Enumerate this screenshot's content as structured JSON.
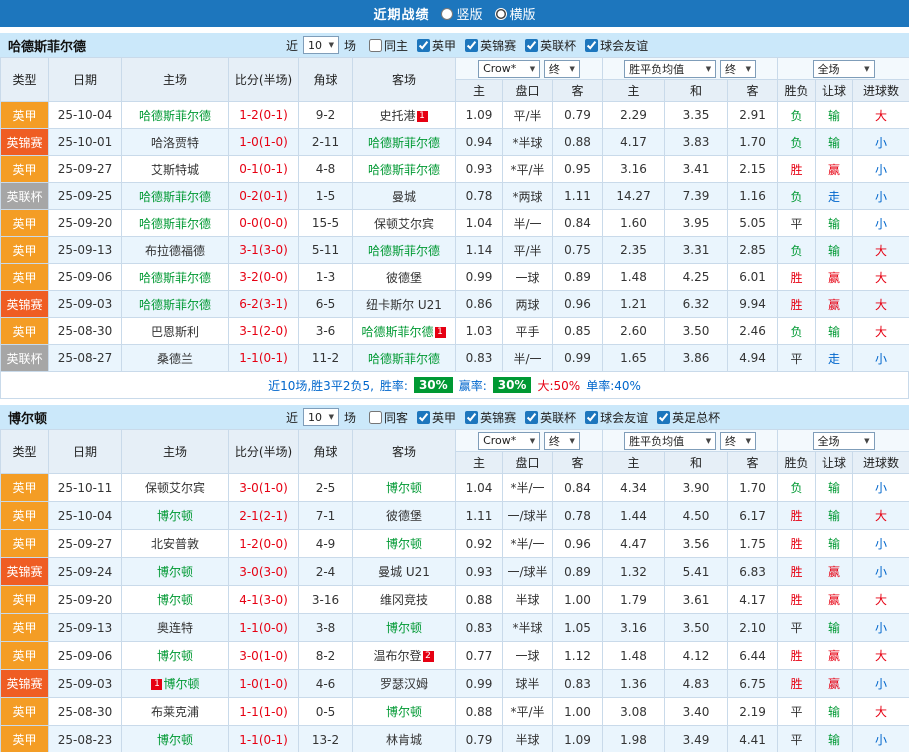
{
  "topbar": {
    "title": "近期战绩",
    "vertical": "竖版",
    "horizontal": "横版"
  },
  "sections": [
    {
      "team": "哈德斯菲尔德",
      "near_label": "近",
      "near_value": "10",
      "games_label": "场",
      "filters": [
        {
          "label": "同主",
          "checked": false
        },
        {
          "label": "英甲",
          "checked": true
        },
        {
          "label": "英锦赛",
          "checked": true
        },
        {
          "label": "英联杯",
          "checked": true
        },
        {
          "label": "球会友谊",
          "checked": true
        }
      ],
      "header": {
        "type": "类型",
        "date": "日期",
        "home": "主场",
        "score": "比分(半场)",
        "corner": "角球",
        "away": "客场",
        "odds_book": "Crow*",
        "odds_final": "终",
        "odds_home": "主",
        "odds_handicap": "盘口",
        "odds_away": "客",
        "avg_label": "胜平负均值",
        "avg_final": "终",
        "avg_home": "主",
        "avg_draw": "和",
        "avg_away": "客",
        "scope": "全场",
        "result": "胜负",
        "handicap_result": "让球",
        "goals": "进球数"
      },
      "rows": [
        {
          "type": "英甲",
          "date": "25-10-04",
          "home": "哈德斯菲尔德",
          "score": "1-2(0-1)",
          "corner": "9-2",
          "away": "史托港",
          "away_badge": "1",
          "odds": [
            "1.09",
            "平/半",
            "0.79"
          ],
          "avg": [
            "2.29",
            "3.35",
            "2.91"
          ],
          "wdl": "负",
          "asian": "输",
          "ou": "大"
        },
        {
          "type": "英锦赛",
          "date": "25-10-01",
          "home": "哈洛贾特",
          "score": "1-0(1-0)",
          "corner": "2-11",
          "away": "哈德斯菲尔德",
          "odds": [
            "0.94",
            "*半球",
            "0.88"
          ],
          "avg": [
            "4.17",
            "3.83",
            "1.70"
          ],
          "wdl": "负",
          "asian": "输",
          "ou": "小"
        },
        {
          "type": "英甲",
          "date": "25-09-27",
          "home": "艾斯特城",
          "score": "0-1(0-1)",
          "corner": "4-8",
          "away": "哈德斯菲尔德",
          "odds": [
            "0.93",
            "*平/半",
            "0.95"
          ],
          "avg": [
            "3.16",
            "3.41",
            "2.15"
          ],
          "wdl": "胜",
          "asian": "赢",
          "ou": "小"
        },
        {
          "type": "英联杯",
          "date": "25-09-25",
          "home": "哈德斯菲尔德",
          "score": "0-2(0-1)",
          "corner": "1-5",
          "away": "曼城",
          "odds": [
            "0.78",
            "*两球",
            "1.11"
          ],
          "avg": [
            "14.27",
            "7.39",
            "1.16"
          ],
          "wdl": "负",
          "asian": "走",
          "ou": "小"
        },
        {
          "type": "英甲",
          "date": "25-09-20",
          "home": "哈德斯菲尔德",
          "score": "0-0(0-0)",
          "corner": "15-5",
          "away": "保顿艾尔宾",
          "odds": [
            "1.04",
            "半/一",
            "0.84"
          ],
          "avg": [
            "1.60",
            "3.95",
            "5.05"
          ],
          "wdl": "平",
          "asian": "输",
          "ou": "小"
        },
        {
          "type": "英甲",
          "date": "25-09-13",
          "home": "布拉德福德",
          "score": "3-1(3-0)",
          "corner": "5-11",
          "away": "哈德斯菲尔德",
          "odds": [
            "1.14",
            "平/半",
            "0.75"
          ],
          "avg": [
            "2.35",
            "3.31",
            "2.85"
          ],
          "wdl": "负",
          "asian": "输",
          "ou": "大"
        },
        {
          "type": "英甲",
          "date": "25-09-06",
          "home": "哈德斯菲尔德",
          "score": "3-2(0-0)",
          "corner": "1-3",
          "away": "彼德堡",
          "odds": [
            "0.99",
            "一球",
            "0.89"
          ],
          "avg": [
            "1.48",
            "4.25",
            "6.01"
          ],
          "wdl": "胜",
          "asian": "赢",
          "ou": "大"
        },
        {
          "type": "英锦赛",
          "date": "25-09-03",
          "home": "哈德斯菲尔德",
          "score": "6-2(3-1)",
          "corner": "6-5",
          "away": "纽卡斯尔 U21",
          "odds": [
            "0.86",
            "两球",
            "0.96"
          ],
          "avg": [
            "1.21",
            "6.32",
            "9.94"
          ],
          "wdl": "胜",
          "asian": "赢",
          "ou": "大"
        },
        {
          "type": "英甲",
          "date": "25-08-30",
          "home": "巴恩斯利",
          "score": "3-1(2-0)",
          "corner": "3-6",
          "away": "哈德斯菲尔德",
          "away_badge": "1",
          "odds": [
            "1.03",
            "平手",
            "0.85"
          ],
          "avg": [
            "2.60",
            "3.50",
            "2.46"
          ],
          "wdl": "负",
          "asian": "输",
          "ou": "大"
        },
        {
          "type": "英联杯",
          "date": "25-08-27",
          "home": "桑德兰",
          "score": "1-1(0-1)",
          "corner": "11-2",
          "away": "哈德斯菲尔德",
          "odds": [
            "0.83",
            "半/一",
            "0.99"
          ],
          "avg": [
            "1.65",
            "3.86",
            "4.94"
          ],
          "wdl": "平",
          "asian": "走",
          "ou": "小"
        }
      ],
      "summary": {
        "prefix": "近10场,胜3平2负5,",
        "win_label": "胜率:",
        "win_value": "30%",
        "odds_label": "赢率:",
        "odds_value": "30%",
        "big": "大:50%",
        "single": "单率:40%"
      }
    },
    {
      "team": "博尔顿",
      "near_label": "近",
      "near_value": "10",
      "games_label": "场",
      "filters": [
        {
          "label": "同客",
          "checked": false
        },
        {
          "label": "英甲",
          "checked": true
        },
        {
          "label": "英锦赛",
          "checked": true
        },
        {
          "label": "英联杯",
          "checked": true
        },
        {
          "label": "球会友谊",
          "checked": true
        },
        {
          "label": "英足总杯",
          "checked": true
        }
      ],
      "header": {
        "type": "类型",
        "date": "日期",
        "home": "主场",
        "score": "比分(半场)",
        "corner": "角球",
        "away": "客场",
        "odds_book": "Crow*",
        "odds_final": "终",
        "odds_home": "主",
        "odds_handicap": "盘口",
        "odds_away": "客",
        "avg_label": "胜平负均值",
        "avg_final": "终",
        "avg_home": "主",
        "avg_draw": "和",
        "avg_away": "客",
        "scope": "全场",
        "result": "胜负",
        "handicap_result": "让球",
        "goals": "进球数"
      },
      "rows": [
        {
          "type": "英甲",
          "date": "25-10-11",
          "home": "保顿艾尔宾",
          "score": "3-0(1-0)",
          "corner": "2-5",
          "away": "博尔顿",
          "odds": [
            "1.04",
            "*半/一",
            "0.84"
          ],
          "avg": [
            "4.34",
            "3.90",
            "1.70"
          ],
          "wdl": "负",
          "asian": "输",
          "ou": "小"
        },
        {
          "type": "英甲",
          "date": "25-10-04",
          "home": "博尔顿",
          "score": "2-1(2-1)",
          "corner": "7-1",
          "away": "彼德堡",
          "odds": [
            "1.11",
            "一/球半",
            "0.78"
          ],
          "avg": [
            "1.44",
            "4.50",
            "6.17"
          ],
          "wdl": "胜",
          "asian": "输",
          "ou": "大"
        },
        {
          "type": "英甲",
          "date": "25-09-27",
          "home": "北安普敦",
          "score": "1-2(0-0)",
          "corner": "4-9",
          "away": "博尔顿",
          "odds": [
            "0.92",
            "*半/一",
            "0.96"
          ],
          "avg": [
            "4.47",
            "3.56",
            "1.75"
          ],
          "wdl": "胜",
          "asian": "输",
          "ou": "小"
        },
        {
          "type": "英锦赛",
          "date": "25-09-24",
          "home": "博尔顿",
          "score": "3-0(3-0)",
          "corner": "2-4",
          "away": "曼城 U21",
          "odds": [
            "0.93",
            "一/球半",
            "0.89"
          ],
          "avg": [
            "1.32",
            "5.41",
            "6.83"
          ],
          "wdl": "胜",
          "asian": "赢",
          "ou": "小"
        },
        {
          "type": "英甲",
          "date": "25-09-20",
          "home": "博尔顿",
          "score": "4-1(3-0)",
          "corner": "3-16",
          "away": "维冈竞技",
          "odds": [
            "0.88",
            "半球",
            "1.00"
          ],
          "avg": [
            "1.79",
            "3.61",
            "4.17"
          ],
          "wdl": "胜",
          "asian": "赢",
          "ou": "大"
        },
        {
          "type": "英甲",
          "date": "25-09-13",
          "home": "奥连特",
          "score": "1-1(0-0)",
          "corner": "3-8",
          "away": "博尔顿",
          "odds": [
            "0.83",
            "*半球",
            "1.05"
          ],
          "avg": [
            "3.16",
            "3.50",
            "2.10"
          ],
          "wdl": "平",
          "asian": "输",
          "ou": "小"
        },
        {
          "type": "英甲",
          "date": "25-09-06",
          "home": "博尔顿",
          "score": "3-0(1-0)",
          "corner": "8-2",
          "away": "温布尔登",
          "away_badge": "2",
          "odds": [
            "0.77",
            "一球",
            "1.12"
          ],
          "avg": [
            "1.48",
            "4.12",
            "6.44"
          ],
          "wdl": "胜",
          "asian": "赢",
          "ou": "大"
        },
        {
          "type": "英锦赛",
          "date": "25-09-03",
          "home": "博尔顿",
          "home_badge_pre": "1",
          "score": "1-0(1-0)",
          "corner": "4-6",
          "away": "罗瑟汉姆",
          "odds": [
            "0.99",
            "球半",
            "0.83"
          ],
          "avg": [
            "1.36",
            "4.83",
            "6.75"
          ],
          "wdl": "胜",
          "asian": "赢",
          "ou": "小"
        },
        {
          "type": "英甲",
          "date": "25-08-30",
          "home": "布莱克浦",
          "score": "1-1(1-0)",
          "corner": "0-5",
          "away": "博尔顿",
          "odds": [
            "0.88",
            "*平/半",
            "1.00"
          ],
          "avg": [
            "3.08",
            "3.40",
            "2.19"
          ],
          "wdl": "平",
          "asian": "输",
          "ou": "大"
        },
        {
          "type": "英甲",
          "date": "25-08-23",
          "home": "博尔顿",
          "score": "1-1(0-1)",
          "corner": "13-2",
          "away": "林肯城",
          "odds": [
            "0.79",
            "半球",
            "1.09"
          ],
          "avg": [
            "1.98",
            "3.49",
            "4.41"
          ],
          "wdl": "平",
          "asian": "输",
          "ou": "小"
        }
      ],
      "summary": null
    }
  ]
}
